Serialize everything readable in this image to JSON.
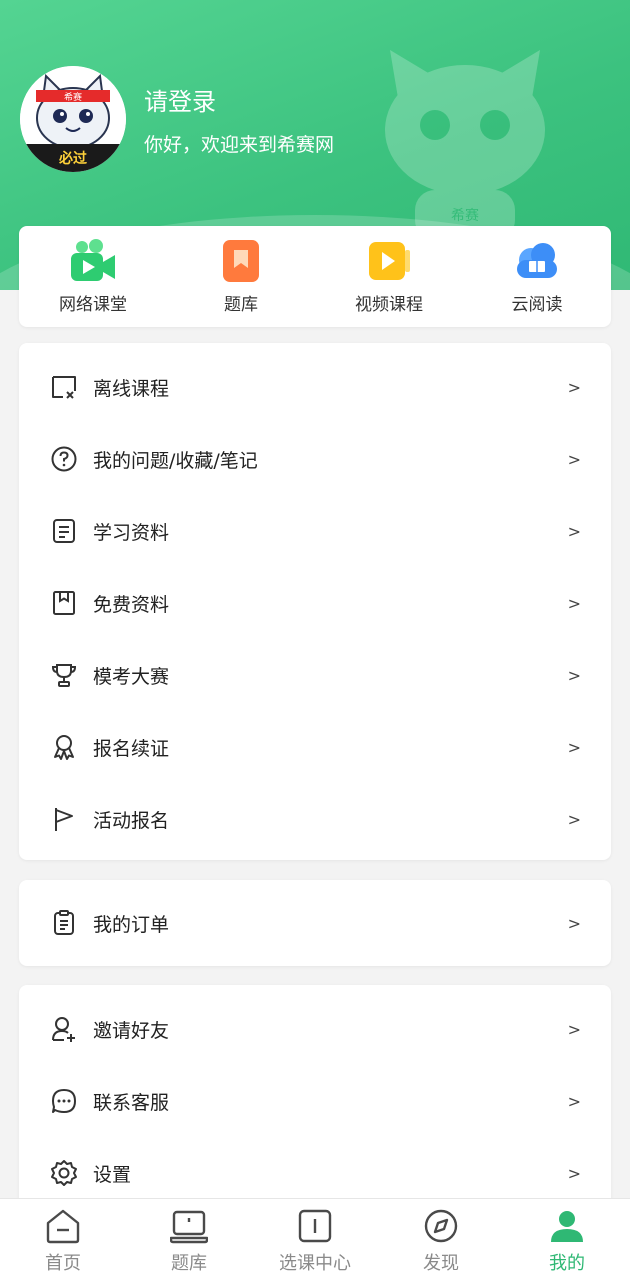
{
  "header": {
    "login_title": "请登录",
    "welcome": "你好，欢迎来到希赛网",
    "avatar": {
      "badge_top": "希赛",
      "badge_bottom": "必过"
    },
    "watermark_text": "希赛"
  },
  "quick_links": [
    {
      "label": "网络课堂",
      "icon": "video-camera-icon",
      "color": "#2ecc71"
    },
    {
      "label": "题库",
      "icon": "bookmark-book-icon",
      "color": "#ff7a3d"
    },
    {
      "label": "视频课程",
      "icon": "play-video-icon",
      "color": "#ffc21a"
    },
    {
      "label": "云阅读",
      "icon": "cloud-book-icon",
      "color": "#3d8ef7"
    }
  ],
  "menu_groups": [
    [
      {
        "label": "离线课程",
        "icon": "offline-screen-icon"
      },
      {
        "label": "我的问题/收藏/笔记",
        "icon": "question-circle-icon"
      },
      {
        "label": "学习资料",
        "icon": "document-icon"
      },
      {
        "label": "免费资料",
        "icon": "bookmark-icon"
      },
      {
        "label": "模考大赛",
        "icon": "trophy-icon"
      },
      {
        "label": "报名续证",
        "icon": "award-ribbon-icon"
      },
      {
        "label": "活动报名",
        "icon": "flag-icon"
      }
    ],
    [
      {
        "label": "我的订单",
        "icon": "clipboard-icon"
      }
    ],
    [
      {
        "label": "邀请好友",
        "icon": "add-user-icon"
      },
      {
        "label": "联系客服",
        "icon": "chat-bubble-icon"
      },
      {
        "label": "设置",
        "icon": "gear-icon"
      }
    ]
  ],
  "chevron": ">",
  "tabs": [
    {
      "label": "首页",
      "icon": "home-icon",
      "active": false
    },
    {
      "label": "题库",
      "icon": "laptop-icon",
      "active": false
    },
    {
      "label": "选课中心",
      "icon": "course-book-icon",
      "active": false
    },
    {
      "label": "发现",
      "icon": "compass-icon",
      "active": false
    },
    {
      "label": "我的",
      "icon": "user-icon",
      "active": true
    }
  ],
  "colors": {
    "brand": "#2fb874",
    "header_light": "#54d492"
  }
}
